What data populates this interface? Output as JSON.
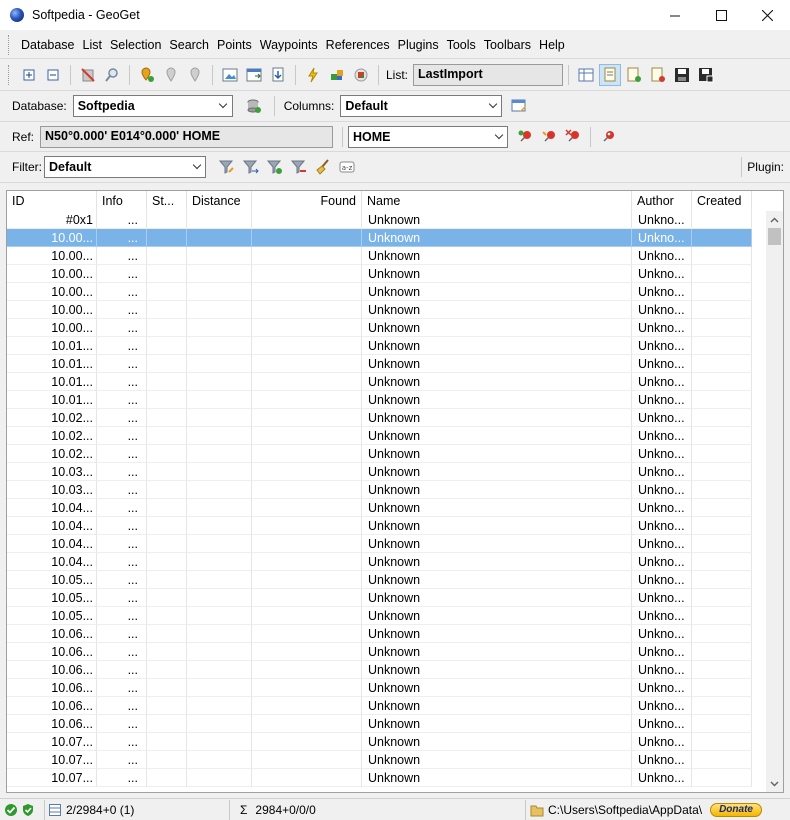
{
  "window": {
    "title": "Softpedia - GeoGet"
  },
  "menu": [
    "Database",
    "List",
    "Selection",
    "Search",
    "Points",
    "Waypoints",
    "References",
    "Plugins",
    "Tools",
    "Toolbars",
    "Help"
  ],
  "toolbar": {
    "list_label": "List:",
    "list_value": "LastImport"
  },
  "database": {
    "label": "Database:",
    "value": "Softpedia"
  },
  "columns": {
    "label": "Columns:",
    "value": "Default"
  },
  "ref": {
    "label": "Ref:",
    "coords": "N50°0.000' E014°0.000' HOME",
    "point": "HOME"
  },
  "filter": {
    "label": "Filter:",
    "value": "Default",
    "sort_badge": "a-z"
  },
  "plugin": {
    "label": "Plugin:"
  },
  "grid": {
    "headers": [
      "ID",
      "Info",
      "St...",
      "Distance",
      "Found",
      "Name",
      "Author",
      "Created"
    ],
    "selected_row": 1,
    "rows": [
      {
        "id": "#0x1",
        "info": "...",
        "name": "Unknown",
        "author": "Unkno..."
      },
      {
        "id": "10.00...",
        "info": "...",
        "name": "Unknown",
        "author": "Unkno..."
      },
      {
        "id": "10.00...",
        "info": "...",
        "name": "Unknown",
        "author": "Unkno..."
      },
      {
        "id": "10.00...",
        "info": "...",
        "name": "Unknown",
        "author": "Unkno..."
      },
      {
        "id": "10.00...",
        "info": "...",
        "name": "Unknown",
        "author": "Unkno..."
      },
      {
        "id": "10.00...",
        "info": "...",
        "name": "Unknown",
        "author": "Unkno..."
      },
      {
        "id": "10.00...",
        "info": "...",
        "name": "Unknown",
        "author": "Unkno..."
      },
      {
        "id": "10.01...",
        "info": "...",
        "name": "Unknown",
        "author": "Unkno..."
      },
      {
        "id": "10.01...",
        "info": "...",
        "name": "Unknown",
        "author": "Unkno..."
      },
      {
        "id": "10.01...",
        "info": "...",
        "name": "Unknown",
        "author": "Unkno..."
      },
      {
        "id": "10.01...",
        "info": "...",
        "name": "Unknown",
        "author": "Unkno..."
      },
      {
        "id": "10.02...",
        "info": "...",
        "name": "Unknown",
        "author": "Unkno..."
      },
      {
        "id": "10.02...",
        "info": "...",
        "name": "Unknown",
        "author": "Unkno..."
      },
      {
        "id": "10.02...",
        "info": "...",
        "name": "Unknown",
        "author": "Unkno..."
      },
      {
        "id": "10.03...",
        "info": "...",
        "name": "Unknown",
        "author": "Unkno..."
      },
      {
        "id": "10.03...",
        "info": "...",
        "name": "Unknown",
        "author": "Unkno..."
      },
      {
        "id": "10.04...",
        "info": "...",
        "name": "Unknown",
        "author": "Unkno..."
      },
      {
        "id": "10.04...",
        "info": "...",
        "name": "Unknown",
        "author": "Unkno..."
      },
      {
        "id": "10.04...",
        "info": "...",
        "name": "Unknown",
        "author": "Unkno..."
      },
      {
        "id": "10.04...",
        "info": "...",
        "name": "Unknown",
        "author": "Unkno..."
      },
      {
        "id": "10.05...",
        "info": "...",
        "name": "Unknown",
        "author": "Unkno..."
      },
      {
        "id": "10.05...",
        "info": "...",
        "name": "Unknown",
        "author": "Unkno..."
      },
      {
        "id": "10.05...",
        "info": "...",
        "name": "Unknown",
        "author": "Unkno..."
      },
      {
        "id": "10.06...",
        "info": "...",
        "name": "Unknown",
        "author": "Unkno..."
      },
      {
        "id": "10.06...",
        "info": "...",
        "name": "Unknown",
        "author": "Unkno..."
      },
      {
        "id": "10.06...",
        "info": "...",
        "name": "Unknown",
        "author": "Unkno..."
      },
      {
        "id": "10.06...",
        "info": "...",
        "name": "Unknown",
        "author": "Unkno..."
      },
      {
        "id": "10.06...",
        "info": "...",
        "name": "Unknown",
        "author": "Unkno..."
      },
      {
        "id": "10.06...",
        "info": "...",
        "name": "Unknown",
        "author": "Unkno..."
      },
      {
        "id": "10.07...",
        "info": "...",
        "name": "Unknown",
        "author": "Unkno..."
      },
      {
        "id": "10.07...",
        "info": "...",
        "name": "Unknown",
        "author": "Unkno..."
      },
      {
        "id": "10.07...",
        "info": "...",
        "name": "Unknown",
        "author": "Unkno..."
      }
    ]
  },
  "status": {
    "count": "2/2984+0 (1)",
    "sigma": "Σ",
    "sum": "2984+0/0/0",
    "path": "C:\\Users\\Softpedia\\AppData\\",
    "donate": "Donate"
  },
  "colors": {
    "selection": "#7ab3e7",
    "chrome": "#f0f0f0"
  }
}
